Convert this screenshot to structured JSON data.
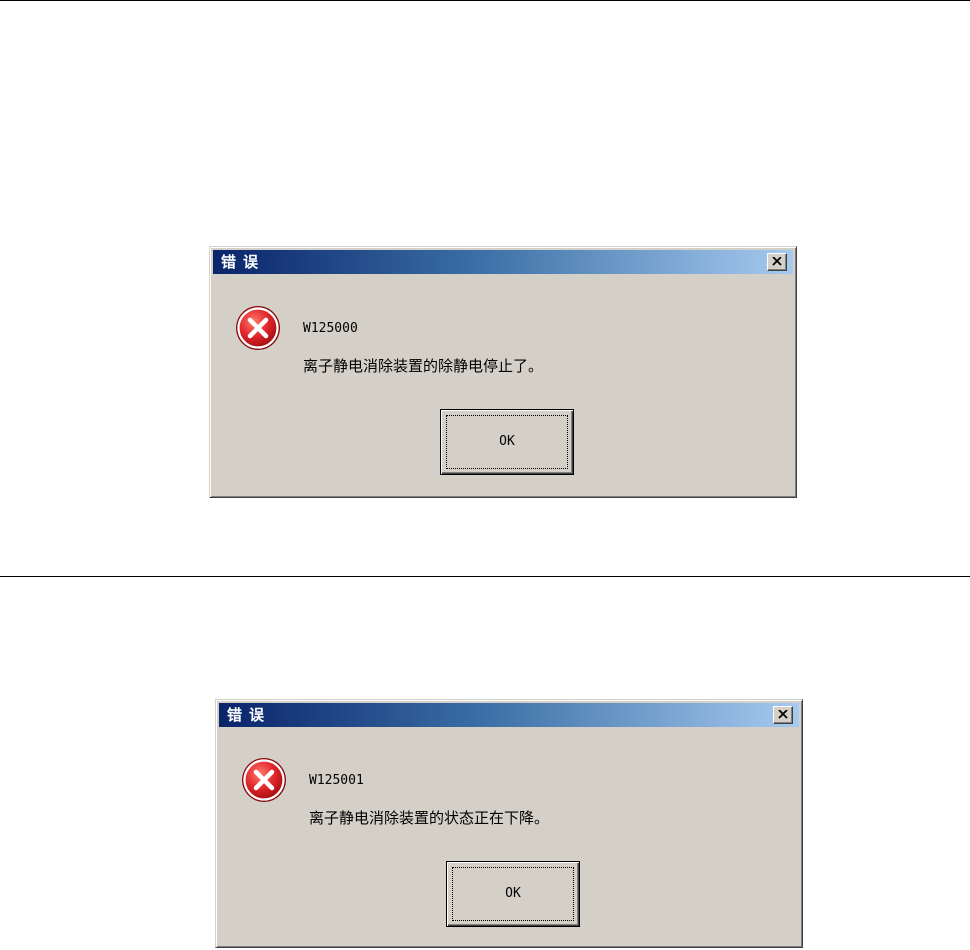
{
  "dialogs": [
    {
      "title": "错误",
      "code": "W125000",
      "message": "离子静电消除装置的除静电停止了。",
      "ok_label": "OK"
    },
    {
      "title": "错误",
      "code": "W125001",
      "message": "离子静电消除装置的状态正在下降。",
      "ok_label": "OK"
    }
  ],
  "icons": {
    "error": "error-icon",
    "close": "close-icon"
  },
  "colors": {
    "dialog_bg": "#d4d0c8",
    "titlebar_start": "#0a246a",
    "titlebar_end": "#a6caf0",
    "error_red": "#e0262a"
  }
}
